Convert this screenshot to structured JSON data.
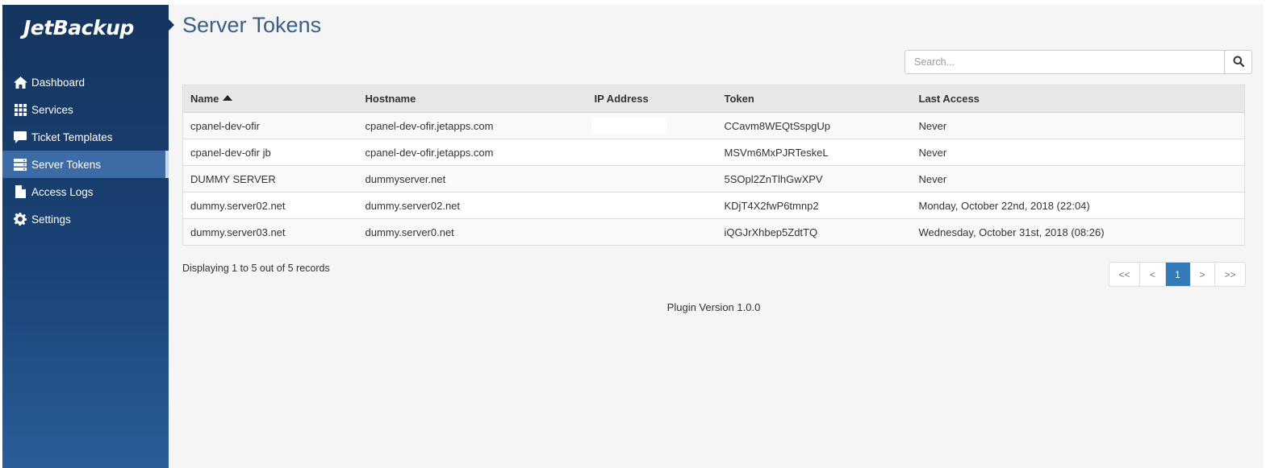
{
  "brand": {
    "logo_text": "JetBackup"
  },
  "sidebar": {
    "items": [
      {
        "label": "Dashboard",
        "icon": "home-icon",
        "active": false
      },
      {
        "label": "Services",
        "icon": "grid-icon",
        "active": false
      },
      {
        "label": "Ticket Templates",
        "icon": "comment-icon",
        "active": false
      },
      {
        "label": "Server Tokens",
        "icon": "server-icon",
        "active": true
      },
      {
        "label": "Access Logs",
        "icon": "file-icon",
        "active": false
      },
      {
        "label": "Settings",
        "icon": "gear-icon",
        "active": false
      }
    ]
  },
  "page": {
    "title": "Server Tokens"
  },
  "search": {
    "placeholder": "Search..."
  },
  "table": {
    "columns": [
      "Name",
      "Hostname",
      "IP Address",
      "Token",
      "Last Access"
    ],
    "sort": {
      "column": "Name",
      "direction": "asc"
    },
    "rows": [
      {
        "name": "cpanel-dev-ofir",
        "hostname": "cpanel-dev-ofir.jetapps.com",
        "ip": "",
        "ip_redacted": true,
        "token": "CCavm8WEQtSspgUp",
        "last_access": "Never"
      },
      {
        "name": "cpanel-dev-ofir jb",
        "hostname": "cpanel-dev-ofir.jetapps.com",
        "ip": "",
        "ip_redacted": true,
        "token": "MSVm6MxPJRTeskeL",
        "last_access": "Never"
      },
      {
        "name": "DUMMY SERVER",
        "hostname": "dummyserver.net",
        "ip": "",
        "ip_redacted": false,
        "token": "5SOpl2ZnTlhGwXPV",
        "last_access": "Never"
      },
      {
        "name": "dummy.server02.net",
        "hostname": "dummy.server02.net",
        "ip": "",
        "ip_redacted": false,
        "token": "KDjT4X2fwP6tmnp2",
        "last_access": "Monday, October 22nd, 2018 (22:04)"
      },
      {
        "name": "dummy.server03.net",
        "hostname": "dummy.server0.net",
        "ip": "",
        "ip_redacted": false,
        "token": "iQGJrXhbep5ZdtTQ",
        "last_access": "Wednesday, October 31st, 2018 (08:26)"
      }
    ]
  },
  "records_text": "Displaying 1 to 5 out of 5 records",
  "pagination": {
    "first": "<<",
    "prev": "<",
    "current": "1",
    "next": ">",
    "last": ">>"
  },
  "footer": {
    "version_text": "Plugin Version 1.0.0"
  },
  "colors": {
    "sidebar_bg": "#1a4276",
    "active_item": "#3c6ba5",
    "title": "#3a5f86",
    "pager_active": "#337ab7"
  }
}
